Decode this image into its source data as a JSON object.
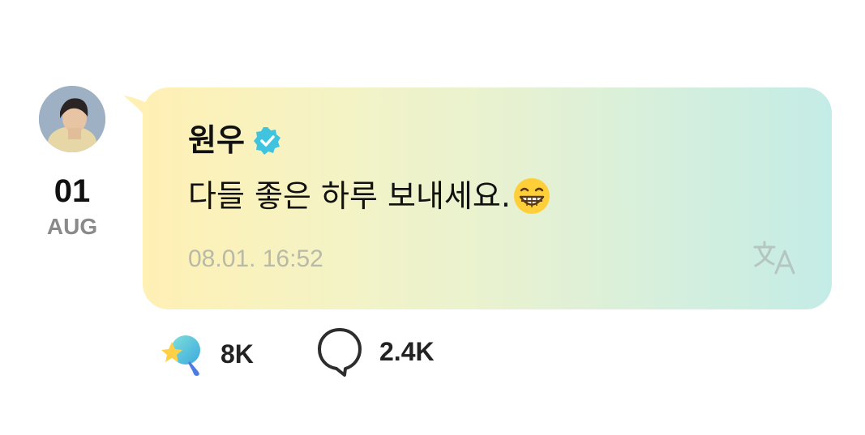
{
  "post": {
    "author": "원우",
    "message": "다들 좋은 하루 보내세요.",
    "timestamp": "08.01. 16:52",
    "emoji": "grinning-face-emoji"
  },
  "date": {
    "day": "01",
    "month": "AUG"
  },
  "actions": {
    "reactions": "8K",
    "comments": "2.4K"
  },
  "icons": {
    "verified": "verified-badge-icon",
    "translate": "translate-icon",
    "reaction": "star-reaction-icon",
    "comment": "comment-bubble-icon"
  },
  "colors": {
    "bubble_start": "#fff0b4",
    "bubble_end": "#c4ece6",
    "verified": "#3fc3de",
    "timestamp": "#b9b9a8"
  }
}
